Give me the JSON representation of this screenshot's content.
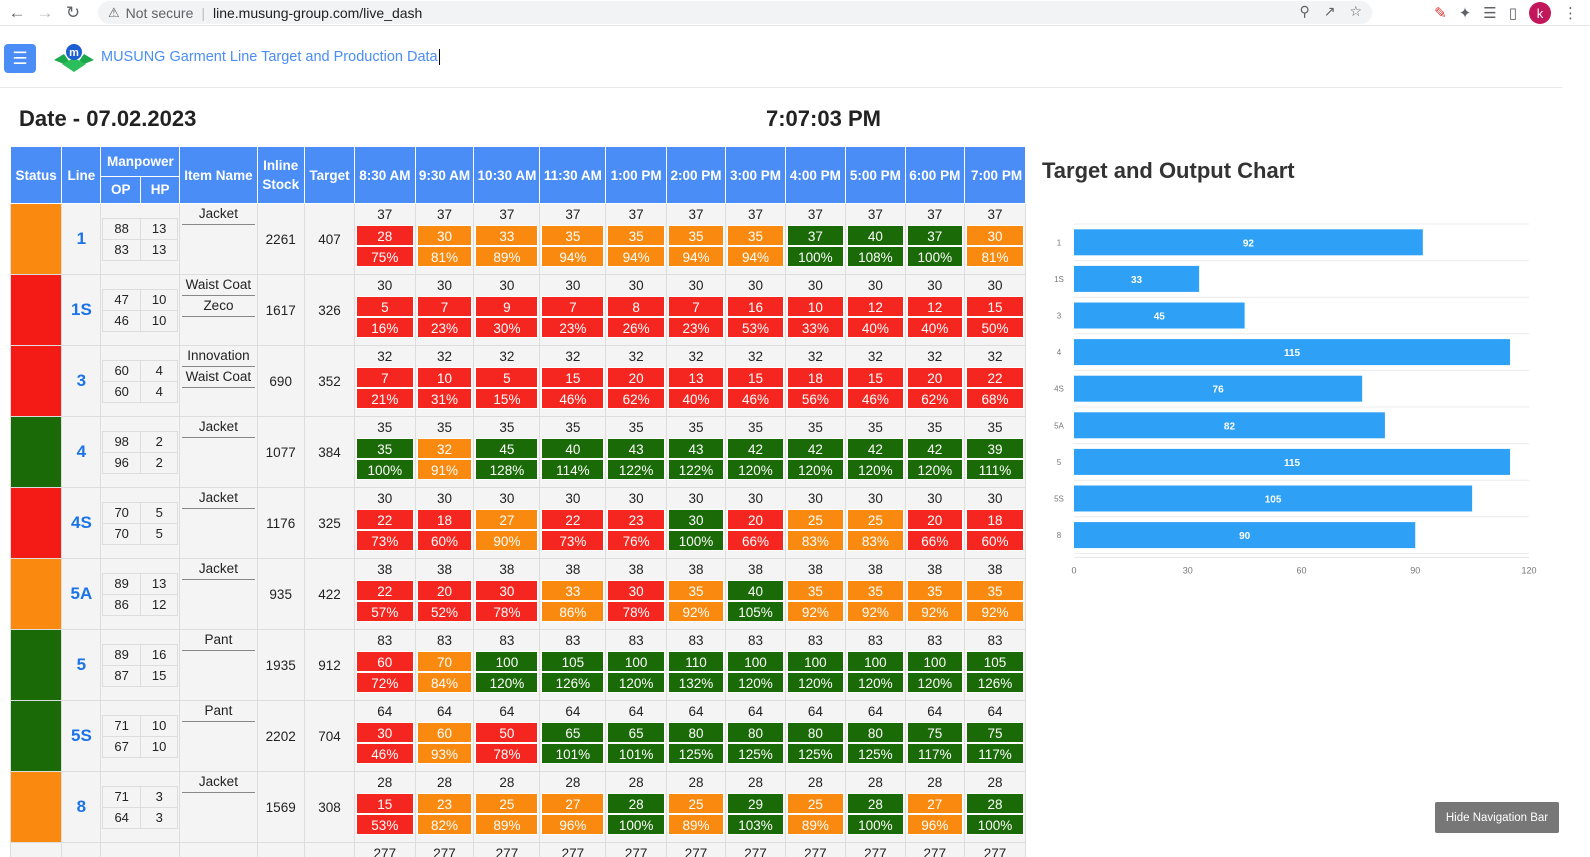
{
  "browser": {
    "security_label": "Not secure",
    "url": "line.musung-group.com/live_dash",
    "avatar_letter": "k"
  },
  "header": {
    "title": "MUSUNG Garment Line Target and Production Data",
    "hide_nav_label": "Hide Navigation Bar"
  },
  "date_label": "Date - 07.02.2023",
  "time_label": "7:07:03 PM",
  "table": {
    "headers": {
      "status": "Status",
      "line": "Line",
      "manpower": "Manpower",
      "op": "OP",
      "hp": "HP",
      "item_name": "Item Name",
      "inline_stock_1": "Inline",
      "inline_stock_2": "Stock",
      "target": "Target"
    },
    "hours": [
      "8:30 AM",
      "9:30 AM",
      "10:30 AM",
      "11:30 AM",
      "1:00 PM",
      "2:00 PM",
      "3:00 PM",
      "4:00 PM",
      "5:00 PM",
      "6:00 PM",
      "7:00 PM"
    ],
    "rows": [
      {
        "status": "#f98a0f",
        "line": "1",
        "op": [
          "88",
          "83"
        ],
        "hp": [
          "13",
          "13"
        ],
        "items": [
          "Jacket"
        ],
        "stock": "2261",
        "target": "407",
        "cells": [
          [
            "37",
            "28",
            "75%",
            "r"
          ],
          [
            "37",
            "30",
            "81%",
            "o"
          ],
          [
            "37",
            "33",
            "89%",
            "o"
          ],
          [
            "37",
            "35",
            "94%",
            "o"
          ],
          [
            "37",
            "35",
            "94%",
            "o"
          ],
          [
            "37",
            "35",
            "94%",
            "o"
          ],
          [
            "37",
            "35",
            "94%",
            "o"
          ],
          [
            "37",
            "37",
            "100%",
            "g"
          ],
          [
            "37",
            "40",
            "108%",
            "g"
          ],
          [
            "37",
            "37",
            "100%",
            "g"
          ],
          [
            "37",
            "30",
            "81%",
            "o"
          ]
        ]
      },
      {
        "status": "#f41a16",
        "line": "1S",
        "op": [
          "47",
          "46"
        ],
        "hp": [
          "10",
          "10"
        ],
        "items": [
          "Waist Coat",
          "Zeco"
        ],
        "stock": "1617",
        "target": "326",
        "cells": [
          [
            "30",
            "5",
            "16%",
            "r"
          ],
          [
            "30",
            "7",
            "23%",
            "r"
          ],
          [
            "30",
            "9",
            "30%",
            "r"
          ],
          [
            "30",
            "7",
            "23%",
            "r"
          ],
          [
            "30",
            "8",
            "26%",
            "r"
          ],
          [
            "30",
            "7",
            "23%",
            "r"
          ],
          [
            "30",
            "16",
            "53%",
            "r"
          ],
          [
            "30",
            "10",
            "33%",
            "r"
          ],
          [
            "30",
            "12",
            "40%",
            "r"
          ],
          [
            "30",
            "12",
            "40%",
            "r"
          ],
          [
            "30",
            "15",
            "50%",
            "r"
          ]
        ]
      },
      {
        "status": "#f41a16",
        "line": "3",
        "op": [
          "60",
          "60"
        ],
        "hp": [
          "4",
          "4"
        ],
        "items": [
          "Innovation",
          "Waist Coat"
        ],
        "stock": "690",
        "target": "352",
        "cells": [
          [
            "32",
            "7",
            "21%",
            "r"
          ],
          [
            "32",
            "10",
            "31%",
            "r"
          ],
          [
            "32",
            "5",
            "15%",
            "r"
          ],
          [
            "32",
            "15",
            "46%",
            "r"
          ],
          [
            "32",
            "20",
            "62%",
            "r"
          ],
          [
            "32",
            "13",
            "40%",
            "r"
          ],
          [
            "32",
            "15",
            "46%",
            "r"
          ],
          [
            "32",
            "18",
            "56%",
            "r"
          ],
          [
            "32",
            "15",
            "46%",
            "r"
          ],
          [
            "32",
            "20",
            "62%",
            "r"
          ],
          [
            "32",
            "22",
            "68%",
            "r"
          ]
        ]
      },
      {
        "status": "#1a6a08",
        "line": "4",
        "op": [
          "98",
          "96"
        ],
        "hp": [
          "2",
          "2"
        ],
        "items": [
          "Jacket"
        ],
        "stock": "1077",
        "target": "384",
        "cells": [
          [
            "35",
            "35",
            "100%",
            "g"
          ],
          [
            "35",
            "32",
            "91%",
            "o"
          ],
          [
            "35",
            "45",
            "128%",
            "g"
          ],
          [
            "35",
            "40",
            "114%",
            "g"
          ],
          [
            "35",
            "43",
            "122%",
            "g"
          ],
          [
            "35",
            "43",
            "122%",
            "g"
          ],
          [
            "35",
            "42",
            "120%",
            "g"
          ],
          [
            "35",
            "42",
            "120%",
            "g"
          ],
          [
            "35",
            "42",
            "120%",
            "g"
          ],
          [
            "35",
            "42",
            "120%",
            "g"
          ],
          [
            "35",
            "39",
            "111%",
            "g"
          ]
        ]
      },
      {
        "status": "#f41a16",
        "line": "4S",
        "op": [
          "70",
          "70"
        ],
        "hp": [
          "5",
          "5"
        ],
        "items": [
          "Jacket"
        ],
        "stock": "1176",
        "target": "325",
        "cells": [
          [
            "30",
            "22",
            "73%",
            "r"
          ],
          [
            "30",
            "18",
            "60%",
            "r"
          ],
          [
            "30",
            "27",
            "90%",
            "o"
          ],
          [
            "30",
            "22",
            "73%",
            "r"
          ],
          [
            "30",
            "23",
            "76%",
            "r"
          ],
          [
            "30",
            "30",
            "100%",
            "g"
          ],
          [
            "30",
            "20",
            "66%",
            "r"
          ],
          [
            "30",
            "25",
            "83%",
            "o"
          ],
          [
            "30",
            "25",
            "83%",
            "o"
          ],
          [
            "30",
            "20",
            "66%",
            "r"
          ],
          [
            "30",
            "18",
            "60%",
            "r"
          ]
        ]
      },
      {
        "status": "#f98a0f",
        "line": "5A",
        "op": [
          "89",
          "86"
        ],
        "hp": [
          "13",
          "12"
        ],
        "items": [
          "Jacket"
        ],
        "stock": "935",
        "target": "422",
        "cells": [
          [
            "38",
            "22",
            "57%",
            "r"
          ],
          [
            "38",
            "20",
            "52%",
            "r"
          ],
          [
            "38",
            "30",
            "78%",
            "r"
          ],
          [
            "38",
            "33",
            "86%",
            "o"
          ],
          [
            "38",
            "30",
            "78%",
            "r"
          ],
          [
            "38",
            "35",
            "92%",
            "o"
          ],
          [
            "38",
            "40",
            "105%",
            "g"
          ],
          [
            "38",
            "35",
            "92%",
            "o"
          ],
          [
            "38",
            "35",
            "92%",
            "o"
          ],
          [
            "38",
            "35",
            "92%",
            "o"
          ],
          [
            "38",
            "35",
            "92%",
            "o"
          ]
        ]
      },
      {
        "status": "#1a6a08",
        "line": "5",
        "op": [
          "89",
          "87"
        ],
        "hp": [
          "16",
          "15"
        ],
        "items": [
          "Pant"
        ],
        "stock": "1935",
        "target": "912",
        "cells": [
          [
            "83",
            "60",
            "72%",
            "r"
          ],
          [
            "83",
            "70",
            "84%",
            "o"
          ],
          [
            "83",
            "100",
            "120%",
            "g"
          ],
          [
            "83",
            "105",
            "126%",
            "g"
          ],
          [
            "83",
            "100",
            "120%",
            "g"
          ],
          [
            "83",
            "110",
            "132%",
            "g"
          ],
          [
            "83",
            "100",
            "120%",
            "g"
          ],
          [
            "83",
            "100",
            "120%",
            "g"
          ],
          [
            "83",
            "100",
            "120%",
            "g"
          ],
          [
            "83",
            "100",
            "120%",
            "g"
          ],
          [
            "83",
            "105",
            "126%",
            "g"
          ]
        ]
      },
      {
        "status": "#1a6a08",
        "line": "5S",
        "op": [
          "71",
          "67"
        ],
        "hp": [
          "10",
          "10"
        ],
        "items": [
          "Pant"
        ],
        "stock": "2202",
        "target": "704",
        "cells": [
          [
            "64",
            "30",
            "46%",
            "r"
          ],
          [
            "64",
            "60",
            "93%",
            "o"
          ],
          [
            "64",
            "50",
            "78%",
            "r"
          ],
          [
            "64",
            "65",
            "101%",
            "g"
          ],
          [
            "64",
            "65",
            "101%",
            "g"
          ],
          [
            "64",
            "80",
            "125%",
            "g"
          ],
          [
            "64",
            "80",
            "125%",
            "g"
          ],
          [
            "64",
            "80",
            "125%",
            "g"
          ],
          [
            "64",
            "80",
            "125%",
            "g"
          ],
          [
            "64",
            "75",
            "117%",
            "g"
          ],
          [
            "64",
            "75",
            "117%",
            "g"
          ]
        ]
      },
      {
        "status": "#f98a0f",
        "line": "8",
        "op": [
          "71",
          "64"
        ],
        "hp": [
          "3",
          "3"
        ],
        "items": [
          "Jacket"
        ],
        "stock": "1569",
        "target": "308",
        "cells": [
          [
            "28",
            "15",
            "53%",
            "r"
          ],
          [
            "28",
            "23",
            "82%",
            "o"
          ],
          [
            "28",
            "25",
            "89%",
            "o"
          ],
          [
            "28",
            "27",
            "96%",
            "o"
          ],
          [
            "28",
            "28",
            "100%",
            "g"
          ],
          [
            "28",
            "25",
            "89%",
            "o"
          ],
          [
            "28",
            "29",
            "103%",
            "g"
          ],
          [
            "28",
            "25",
            "89%",
            "o"
          ],
          [
            "28",
            "28",
            "100%",
            "g"
          ],
          [
            "28",
            "27",
            "96%",
            "o"
          ],
          [
            "28",
            "28",
            "100%",
            "g"
          ]
        ]
      }
    ],
    "partial_row_targets": [
      "277",
      "277",
      "277",
      "277",
      "277",
      "277",
      "277",
      "277",
      "277",
      "277",
      "277"
    ]
  },
  "chart_data": {
    "type": "bar",
    "orientation": "horizontal",
    "title": "Target and Output Chart",
    "categories": [
      "1",
      "1S",
      "3",
      "4",
      "4S",
      "5A",
      "5",
      "5S",
      "8"
    ],
    "values": [
      92,
      33,
      45,
      115,
      76,
      82,
      115,
      105,
      90
    ],
    "xlim": [
      0,
      120
    ],
    "xticks": [
      0,
      30,
      60,
      90,
      120
    ],
    "bar_color": "#2ea1f7",
    "grid": true
  },
  "colors": {
    "accent": "#4a8df6",
    "red": "#f52520",
    "orange": "#f98a0f",
    "green": "#1a6a08"
  }
}
